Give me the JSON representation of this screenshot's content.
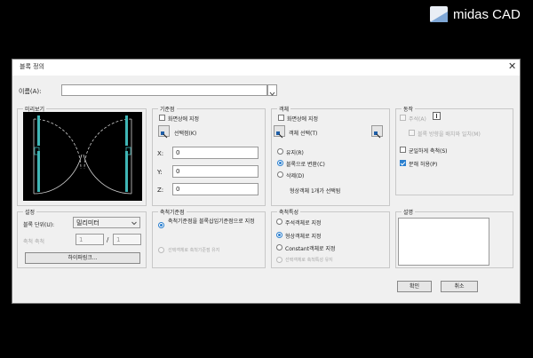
{
  "brand": {
    "name": "midas CAD"
  },
  "dialog": {
    "title": "블록 정의",
    "close": "✕"
  },
  "name": {
    "label": "이름(A):",
    "value": ""
  },
  "preview": {
    "label": "미리보기"
  },
  "base": {
    "label": "기준점",
    "on_screen": "화면상에 지정",
    "pick": "선택점(K)",
    "x_label": "X:",
    "x": "0",
    "y_label": "Y:",
    "y": "0",
    "z_label": "Z:",
    "z": "0"
  },
  "objects": {
    "label": "객체",
    "on_screen": "화면상에 지정",
    "select": "객체 선택(T)",
    "retain": "유지(R)",
    "convert": "블록으로 변환(C)",
    "delete": "삭제(D)",
    "status": "형상객체 1개가 선택됨"
  },
  "behavior": {
    "label": "동작",
    "annotative": "주석(A)",
    "match_orient": "블록 방향을 배치와 일치(M)",
    "uniform": "균일하게 축척(S)",
    "explode": "분해 허용(P)"
  },
  "settings": {
    "label": "설정",
    "unit_label": "블록 단위(U):",
    "unit_value": "밀리미터",
    "scale_label": "축척 축척",
    "scale_a": "1",
    "scale_sep": "/",
    "scale_b": "1",
    "hyperlink": "하이퍼링크..."
  },
  "scale_base": {
    "label": "축척기준점",
    "opt1": "축척기준점을 블록삽입기준점으로 지정",
    "opt2": "선택객체로 축척기준점 유지"
  },
  "scale_prop": {
    "label": "축척특성",
    "opt1": "주석객체로 지정",
    "opt2": "형상객체로 지정",
    "opt3": "Constant객체로 지정",
    "opt4": "선택객체로 축척특성 유지"
  },
  "description": {
    "label": "설명",
    "value": ""
  },
  "buttons": {
    "ok": "확인",
    "cancel": "취소"
  }
}
